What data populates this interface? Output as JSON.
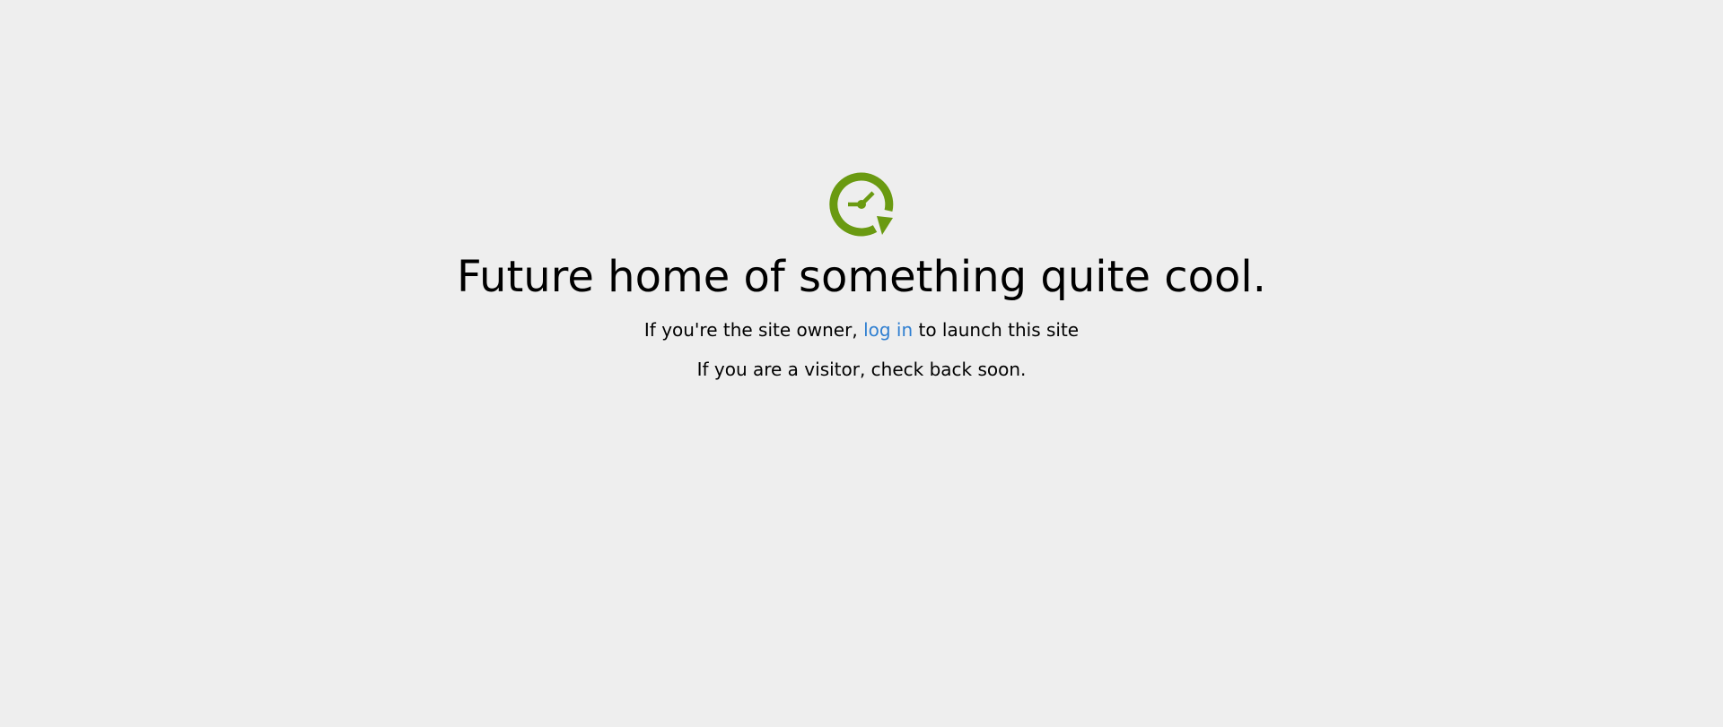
{
  "brand": {
    "icon": "clock-refresh-icon",
    "color": "#6a9a11"
  },
  "headline": "Future home of something quite cool.",
  "owner_message": {
    "prefix": "If you're the site owner, ",
    "link_label": "log in",
    "suffix": " to launch this site"
  },
  "visitor_message": "If you are a visitor, check back soon.",
  "colors": {
    "background": "#eeeeee",
    "link": "#2f7fd1",
    "text": "#000000"
  }
}
